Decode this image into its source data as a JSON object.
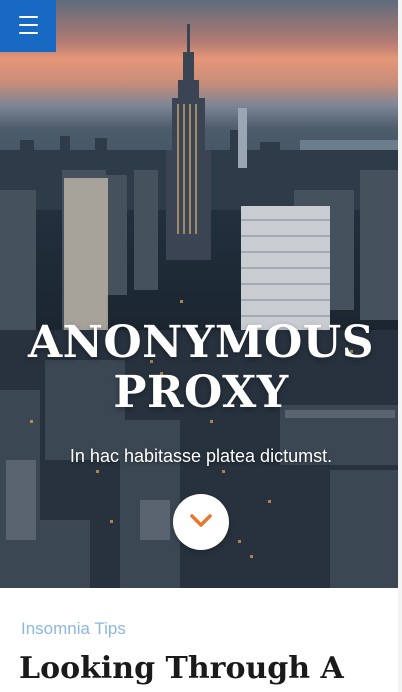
{
  "header": {
    "menu_icon": "hamburger-menu-icon",
    "accent_color": "#1769c4"
  },
  "hero": {
    "title_line1": "ANONYMOUS",
    "title_line2": "PROXY",
    "subtitle": "In hac habitasse platea dictumst.",
    "scroll_icon": "chevron-down-icon",
    "scroll_icon_color": "#e8772e"
  },
  "post": {
    "category": "Insomnia Tips",
    "title": "Looking Through A"
  }
}
